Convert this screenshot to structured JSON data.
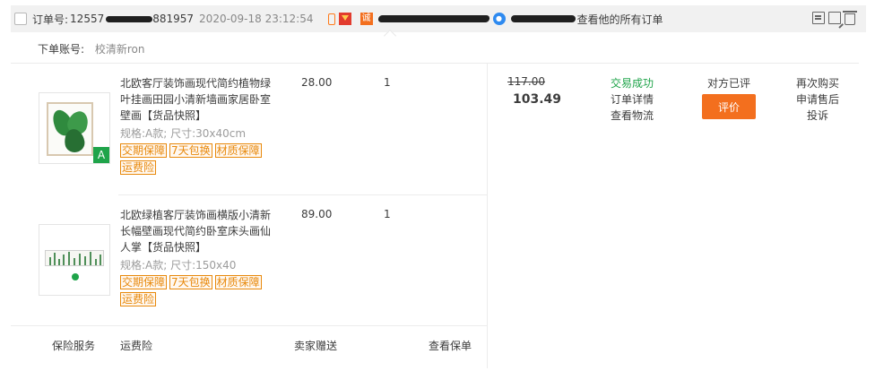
{
  "header": {
    "order_label": "订单号:",
    "order_no": "12557",
    "order_no_tail": "881957",
    "order_time": "2020-09-18 23:12:54",
    "shop_icon_text": "诚",
    "shop_avatar_text": "●",
    "view_all_orders": "查看他的所有订单"
  },
  "account": {
    "label": "下单账号:",
    "value": "校清新ron"
  },
  "items": [
    {
      "title": "北欧客厅装饰画现代简约植物绿叶挂画田园小清新墙画家居卧室壁画",
      "snapshot": "【货品快照】",
      "spec": "规格:A款;  尺寸:30x40cm",
      "price": "28.00",
      "qty": "1",
      "badge": "A",
      "tags": [
        "交期保障",
        "7天包换",
        "材质保障",
        "运费险"
      ]
    },
    {
      "title": "北欧绿植客厅装饰画横版小清新长幅壁画现代简约卧室床头画仙人掌",
      "snapshot": "【货品快照】",
      "spec": "规格:A款;  尺寸:150x40",
      "price": "89.00",
      "qty": "1",
      "tags": [
        "交期保障",
        "7天包换",
        "材质保障",
        "运费险"
      ]
    }
  ],
  "summary": {
    "original_price": "117.00",
    "total": "103.49",
    "status": "交易成功",
    "order_detail": "订单详情",
    "view_logistics": "查看物流",
    "review_status": "对方已评",
    "review_button": "评价",
    "buy_again": "再次购买",
    "apply_after_sale": "申请售后",
    "complain": "投诉"
  },
  "footer": {
    "insurance_service": "保险服务",
    "freight_insurance": "运费险",
    "seller_gift": "卖家赠送",
    "view_policy": "查看保单"
  },
  "colors": {
    "accent_orange": "#f36f1e",
    "success_green": "#1fa44a",
    "tag_orange": "#e8890c"
  }
}
